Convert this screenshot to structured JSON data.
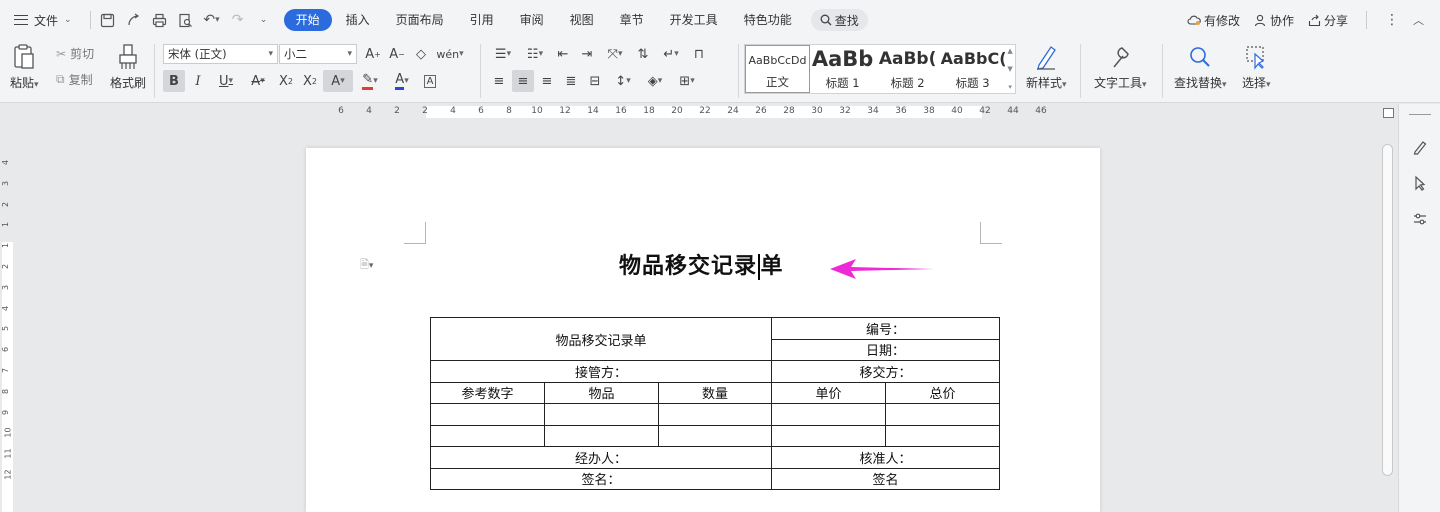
{
  "menubar": {
    "file_label": "文件",
    "tabs": [
      "开始",
      "插入",
      "页面布局",
      "引用",
      "审阅",
      "视图",
      "章节",
      "开发工具",
      "特色功能"
    ],
    "active_tab": "开始",
    "search_label": "查找",
    "right": {
      "modified": "有修改",
      "collab": "协作",
      "share": "分享"
    }
  },
  "ribbon": {
    "paste": "粘贴",
    "cut": "剪切",
    "copy": "复制",
    "format_painter": "格式刷",
    "font_name": "宋体 (正文)",
    "font_size": "小二",
    "styles": [
      {
        "preview": "AaBbCcDd",
        "label": "正文"
      },
      {
        "preview": "AaBb",
        "label": "标题 1"
      },
      {
        "preview": "AaBb(",
        "label": "标题 2"
      },
      {
        "preview": "AaBbC(",
        "label": "标题 3"
      }
    ],
    "new_style": "新样式",
    "text_tools": "文字工具",
    "find_replace": "查找替换",
    "select": "选择"
  },
  "ruler": {
    "h_ticks": [
      "6",
      "4",
      "2",
      "2",
      "4",
      "6",
      "8",
      "10",
      "12",
      "14",
      "16",
      "18",
      "20",
      "22",
      "24",
      "26",
      "28",
      "30",
      "32",
      "34",
      "36",
      "38",
      "40",
      "42",
      "44",
      "46"
    ],
    "v_ticks": [
      "4",
      "3",
      "2",
      "1",
      "1",
      "2",
      "3",
      "4",
      "5",
      "6",
      "7",
      "8",
      "9",
      "10",
      "11",
      "12"
    ]
  },
  "document": {
    "title_before_caret": "物品移交记录",
    "title_after_caret": "单",
    "annotation_color": "#ee2ad6",
    "table": {
      "title": "物品移交记录单",
      "number_label": "编号：",
      "date_label": "日期：",
      "receiver_label": "接管方：",
      "transferer_label": "移交方：",
      "headers": [
        "参考数字",
        "物品",
        "数量",
        "单价",
        "总价"
      ],
      "handler_label": "经办人：",
      "approver_label": "核准人：",
      "signature_left": "签名：",
      "signature_right": "签名"
    }
  },
  "colors": {
    "accent": "#2c6bdd",
    "ribbon_bg": "#f3f4f6",
    "canvas_bg": "#e8e9eb"
  }
}
